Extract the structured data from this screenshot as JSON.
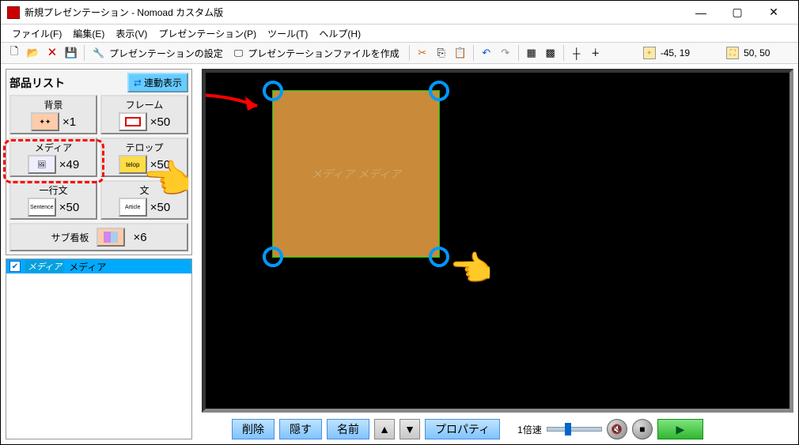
{
  "window": {
    "title": "新規プレゼンテーション - Nomoad カスタム版"
  },
  "menu": {
    "file": "ファイル(F)",
    "edit": "編集(E)",
    "view": "表示(V)",
    "presentation": "プレゼンテーション(P)",
    "tool": "ツール(T)",
    "help": "ヘルプ(H)"
  },
  "toolbar": {
    "settings_label": "プレゼンテーションの設定",
    "makefile_label": "プレゼンテーションファイルを作成",
    "coord1": "-45, 19",
    "coord2": "50, 50"
  },
  "parts": {
    "header": "部品リスト",
    "linked_button": "連動表示",
    "items": [
      {
        "label": "背景",
        "count": "×1",
        "icon": "bg"
      },
      {
        "label": "フレーム",
        "count": "×50",
        "icon": "frame"
      },
      {
        "label": "メディア",
        "count": "×49",
        "icon": "media"
      },
      {
        "label": "テロップ",
        "count": "×50",
        "icon": "telop"
      },
      {
        "label": "一行文",
        "count": "×50",
        "icon": "sentence"
      },
      {
        "label": "文",
        "count": "×50",
        "icon": "article"
      },
      {
        "label": "サブ看板",
        "count": "×6",
        "icon": "sub"
      }
    ]
  },
  "objects": [
    {
      "type": "メディア",
      "name": "メディア"
    }
  ],
  "canvas": {
    "selected_label": "メディア メディア"
  },
  "bottom": {
    "delete": "削除",
    "hide": "隠す",
    "name": "名前",
    "property": "プロパティ",
    "speed": "1倍速",
    "play": "▶"
  }
}
